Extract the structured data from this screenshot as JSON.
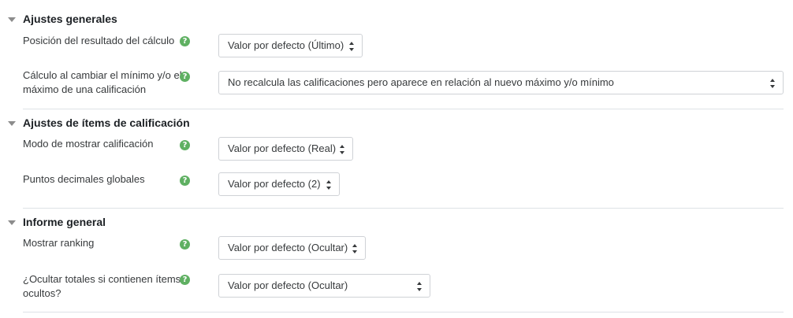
{
  "sections": [
    {
      "title": "Ajustes generales",
      "fields": [
        {
          "label": "Posición del resultado del cálculo",
          "value": "Valor por defecto (Último)"
        },
        {
          "label_line1": "Cálculo al cambiar el mínimo y/o el",
          "label_line2": "máximo de una calificación",
          "value": "No recalcula las calificaciones pero aparece en relación al nuevo máximo y/o mínimo"
        }
      ]
    },
    {
      "title": "Ajustes de ítems de calificación",
      "fields": [
        {
          "label": "Modo de mostrar calificación",
          "value": "Valor por defecto (Real)"
        },
        {
          "label": "Puntos decimales globales",
          "value": "Valor por defecto (2)"
        }
      ]
    },
    {
      "title": "Informe general",
      "fields": [
        {
          "label": "Mostrar ranking",
          "value": "Valor por defecto (Ocultar)"
        },
        {
          "label_line1": "¿Ocultar totales si contienen ítems",
          "label_line2": "ocultos?",
          "value": "Valor por defecto (Ocultar)"
        }
      ]
    }
  ],
  "help_icon_glyph": "?",
  "colors": {
    "help_icon": "#5fb062",
    "divider": "#dee2e6"
  }
}
